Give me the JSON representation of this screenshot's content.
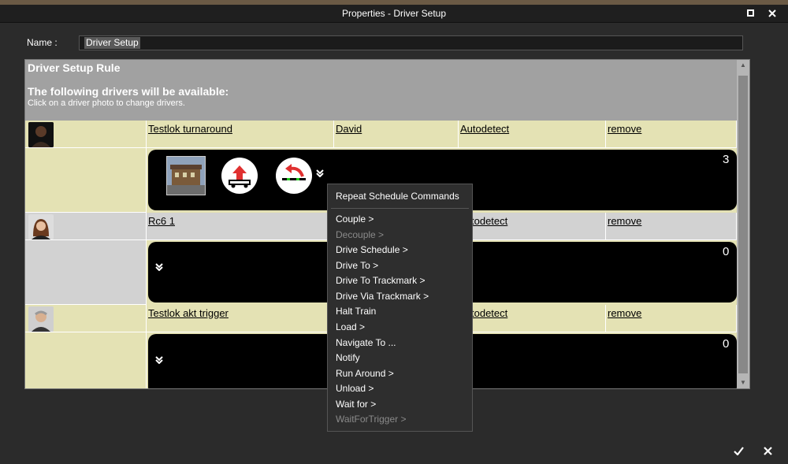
{
  "window": {
    "title": "Properties - Driver Setup",
    "maximize_icon": "square-icon",
    "close_icon": "close-icon"
  },
  "name_field": {
    "label": "Name :",
    "value": "Driver Setup"
  },
  "panel": {
    "title": "Driver Setup Rule",
    "subtitle": "The following drivers will be available:",
    "hint": "Click on a driver photo to change drivers."
  },
  "drivers": [
    {
      "train": "Testlok turnaround",
      "driver": "David",
      "mode": "Autodetect",
      "remove": "remove",
      "count": "3"
    },
    {
      "train": "Rc6 1",
      "driver": "",
      "mode": "todetect",
      "remove": "remove",
      "count": "0"
    },
    {
      "train": "Testlok akt trigger",
      "driver": "",
      "mode": "todetect",
      "remove": "remove",
      "count": "0"
    }
  ],
  "menu": {
    "items": [
      {
        "label": "Repeat Schedule Commands",
        "enabled": true
      },
      {
        "label": "Couple >",
        "enabled": true
      },
      {
        "label": "Decouple >",
        "enabled": false
      },
      {
        "label": "Drive Schedule >",
        "enabled": true
      },
      {
        "label": "Drive To >",
        "enabled": true
      },
      {
        "label": "Drive To Trackmark >",
        "enabled": true
      },
      {
        "label": "Drive Via Trackmark >",
        "enabled": true
      },
      {
        "label": "Halt Train",
        "enabled": true
      },
      {
        "label": "Load >",
        "enabled": true
      },
      {
        "label": "Navigate To ...",
        "enabled": true
      },
      {
        "label": "Notify",
        "enabled": true
      },
      {
        "label": "Run Around >",
        "enabled": true
      },
      {
        "label": "Unload >",
        "enabled": true
      },
      {
        "label": "Wait for >",
        "enabled": true
      },
      {
        "label": "WaitForTrigger >",
        "enabled": false
      }
    ]
  },
  "footer": {
    "ok_icon": "checkmark-icon",
    "cancel_icon": "close-icon"
  },
  "colors": {
    "row_even": "#e4e2b4",
    "row_odd": "#d2d2d2",
    "header": "#a1a1a1",
    "menu_bg": "#2e2e2e",
    "disabled": "#8a8a8a"
  }
}
